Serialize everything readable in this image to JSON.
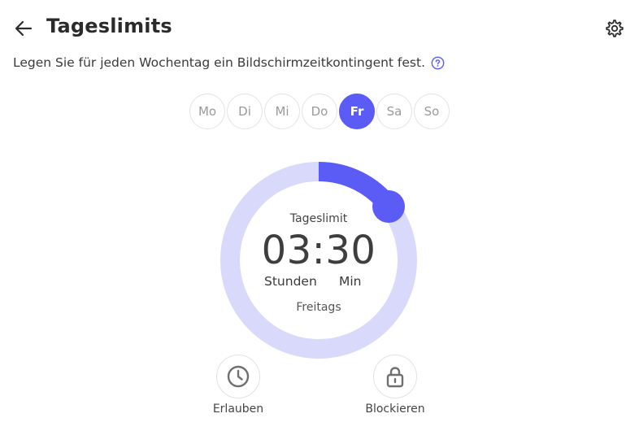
{
  "header": {
    "title": "Tageslimits",
    "back_icon": "arrow-left-icon",
    "settings_icon": "gear-icon"
  },
  "subtitle": {
    "text": "Legen Sie für jeden Wochentag ein Bildschirmzeitkontingent fest.",
    "help_icon": "question-circle-icon"
  },
  "days": [
    {
      "label": "Mo",
      "selected": false
    },
    {
      "label": "Di",
      "selected": false
    },
    {
      "label": "Mi",
      "selected": false
    },
    {
      "label": "Do",
      "selected": false
    },
    {
      "label": "Fr",
      "selected": true
    },
    {
      "label": "Sa",
      "selected": false
    },
    {
      "label": "So",
      "selected": false
    }
  ],
  "dial": {
    "caption": "Tageslimit",
    "time": "03:30",
    "hours_label": "Stunden",
    "minutes_label": "Min",
    "day_label": "Freitags",
    "progress_fraction": 0.146
  },
  "actions": {
    "allow": {
      "label": "Erlauben",
      "icon": "clock-icon"
    },
    "block": {
      "label": "Blockieren",
      "icon": "lock-icon"
    }
  },
  "colors": {
    "accent": "#5b5bf5",
    "track": "#d9d9fc",
    "text": "#2b2b2b",
    "muted": "#9a9a9a"
  }
}
